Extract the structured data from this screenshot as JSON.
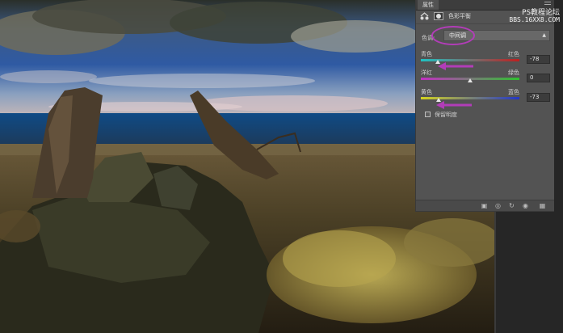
{
  "panel": {
    "tab_label": "属性",
    "adjustment_title": "色彩平衡",
    "tone": {
      "label": "色调:",
      "value": "中间调"
    },
    "sliders": [
      {
        "left_label": "青色",
        "right_label": "红色",
        "value": "-78",
        "fraction": 0.17
      },
      {
        "left_label": "洋红",
        "right_label": "绿色",
        "value": "0",
        "fraction": 0.5
      },
      {
        "left_label": "黄色",
        "right_label": "蓝色",
        "value": "-73",
        "fraction": 0.18
      }
    ],
    "preserve_luminosity": {
      "label": "保留明度",
      "checked": false
    }
  },
  "watermark": {
    "line1": "PS教程论坛",
    "line2": "BBS.16XX8.COM"
  },
  "annotation_color": "#b23db8",
  "icons": [
    "color-balance-icon",
    "mask-icon",
    "panel-menu-icon",
    "clip-to-layer-icon",
    "view-previous-icon",
    "reset-icon",
    "visibility-icon",
    "delete-icon"
  ]
}
